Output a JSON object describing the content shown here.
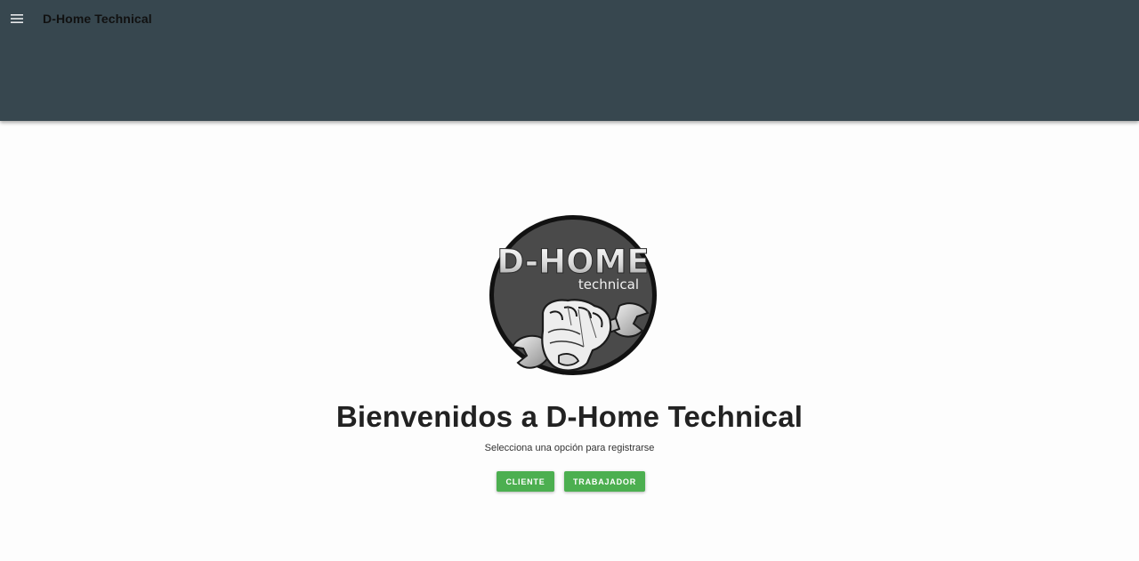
{
  "header": {
    "title": "D-Home Technical",
    "menu_icon": "menu-icon",
    "background": "#37474f"
  },
  "logo": {
    "main_text": "D-HOME",
    "sub_text": "technical"
  },
  "main": {
    "headline": "Bienvenidos a D-Home Technical",
    "subtitle": "Selecciona una opción para registrarse",
    "buttons": {
      "cliente": "CLIENTE",
      "trabajador": "TRABAJADOR"
    },
    "accent": "#4caf50"
  }
}
